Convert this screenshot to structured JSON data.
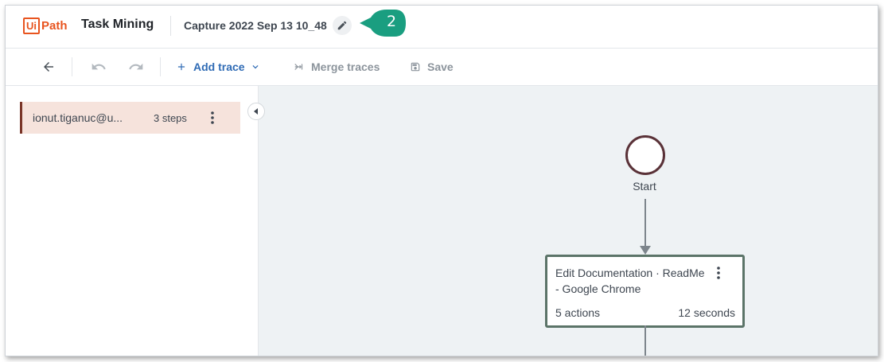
{
  "app": {
    "logo_ui": "Ui",
    "logo_path": "Path",
    "product": "Task Mining",
    "capture_title": "Capture 2022 Sep 13 10_48"
  },
  "callout": {
    "label": "2",
    "color": "#1a9e80"
  },
  "toolbar": {
    "add_trace_label": "Add trace",
    "merge_traces_label": "Merge traces",
    "save_label": "Save"
  },
  "traces": [
    {
      "user": "ionut.tiganuc@u...",
      "steps": "3 steps"
    }
  ],
  "graph": {
    "start_label": "Start",
    "step": {
      "title": "Edit Documentation · ReadMe - Google Chrome",
      "actions": "5 actions",
      "duration": "12 seconds"
    }
  },
  "colors": {
    "brand": "#e8541f",
    "accent": "#2f6bb5",
    "trace_highlight": "#f6e3dc",
    "canvas_bg": "#eef2f4"
  }
}
